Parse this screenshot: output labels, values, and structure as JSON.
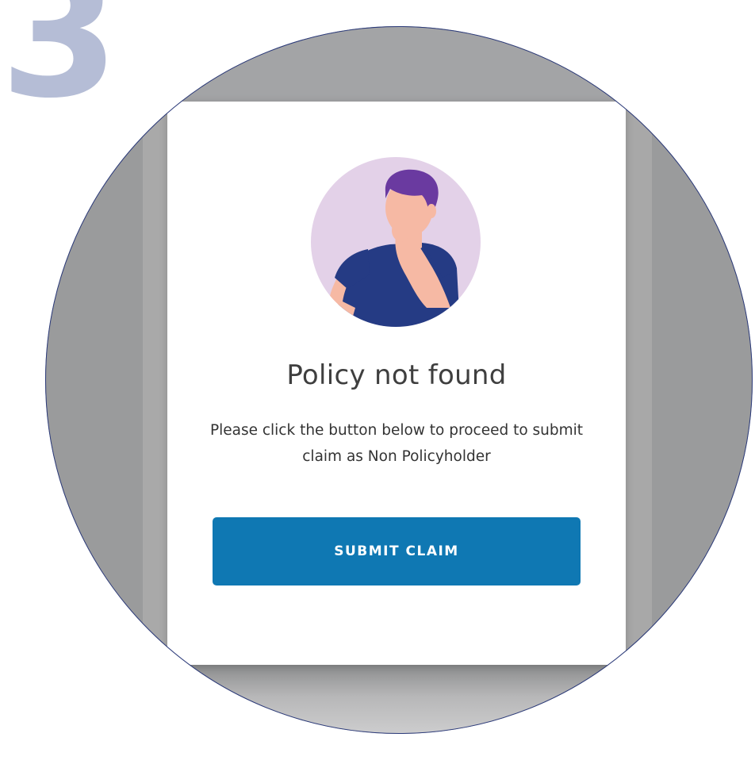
{
  "step": {
    "number": "3",
    "color": "#b5bdd6"
  },
  "modal": {
    "title": "Policy not found",
    "description": "Please click the button below to proceed to submit claim as Non Policyholder",
    "submit_label": "SUBMIT CLAIM",
    "avatar_icon": "thinking-person-icon"
  },
  "colors": {
    "accent": "#0f78b3",
    "avatar_bg": "#e3d1e8",
    "outline": "#2b3a7a",
    "shirt": "#253b84",
    "hair": "#6a3aa0",
    "skin": "#f6b9a4"
  }
}
